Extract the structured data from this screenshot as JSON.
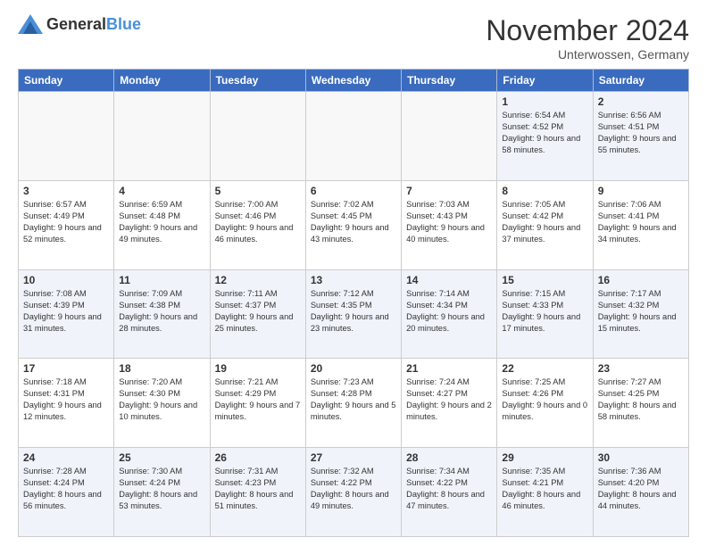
{
  "header": {
    "logo_general": "General",
    "logo_blue": "Blue",
    "month_title": "November 2024",
    "location": "Unterwossen, Germany"
  },
  "weekdays": [
    "Sunday",
    "Monday",
    "Tuesday",
    "Wednesday",
    "Thursday",
    "Friday",
    "Saturday"
  ],
  "weeks": [
    [
      {
        "day": "",
        "info": ""
      },
      {
        "day": "",
        "info": ""
      },
      {
        "day": "",
        "info": ""
      },
      {
        "day": "",
        "info": ""
      },
      {
        "day": "",
        "info": ""
      },
      {
        "day": "1",
        "info": "Sunrise: 6:54 AM\nSunset: 4:52 PM\nDaylight: 9 hours and 58 minutes."
      },
      {
        "day": "2",
        "info": "Sunrise: 6:56 AM\nSunset: 4:51 PM\nDaylight: 9 hours and 55 minutes."
      }
    ],
    [
      {
        "day": "3",
        "info": "Sunrise: 6:57 AM\nSunset: 4:49 PM\nDaylight: 9 hours and 52 minutes."
      },
      {
        "day": "4",
        "info": "Sunrise: 6:59 AM\nSunset: 4:48 PM\nDaylight: 9 hours and 49 minutes."
      },
      {
        "day": "5",
        "info": "Sunrise: 7:00 AM\nSunset: 4:46 PM\nDaylight: 9 hours and 46 minutes."
      },
      {
        "day": "6",
        "info": "Sunrise: 7:02 AM\nSunset: 4:45 PM\nDaylight: 9 hours and 43 minutes."
      },
      {
        "day": "7",
        "info": "Sunrise: 7:03 AM\nSunset: 4:43 PM\nDaylight: 9 hours and 40 minutes."
      },
      {
        "day": "8",
        "info": "Sunrise: 7:05 AM\nSunset: 4:42 PM\nDaylight: 9 hours and 37 minutes."
      },
      {
        "day": "9",
        "info": "Sunrise: 7:06 AM\nSunset: 4:41 PM\nDaylight: 9 hours and 34 minutes."
      }
    ],
    [
      {
        "day": "10",
        "info": "Sunrise: 7:08 AM\nSunset: 4:39 PM\nDaylight: 9 hours and 31 minutes."
      },
      {
        "day": "11",
        "info": "Sunrise: 7:09 AM\nSunset: 4:38 PM\nDaylight: 9 hours and 28 minutes."
      },
      {
        "day": "12",
        "info": "Sunrise: 7:11 AM\nSunset: 4:37 PM\nDaylight: 9 hours and 25 minutes."
      },
      {
        "day": "13",
        "info": "Sunrise: 7:12 AM\nSunset: 4:35 PM\nDaylight: 9 hours and 23 minutes."
      },
      {
        "day": "14",
        "info": "Sunrise: 7:14 AM\nSunset: 4:34 PM\nDaylight: 9 hours and 20 minutes."
      },
      {
        "day": "15",
        "info": "Sunrise: 7:15 AM\nSunset: 4:33 PM\nDaylight: 9 hours and 17 minutes."
      },
      {
        "day": "16",
        "info": "Sunrise: 7:17 AM\nSunset: 4:32 PM\nDaylight: 9 hours and 15 minutes."
      }
    ],
    [
      {
        "day": "17",
        "info": "Sunrise: 7:18 AM\nSunset: 4:31 PM\nDaylight: 9 hours and 12 minutes."
      },
      {
        "day": "18",
        "info": "Sunrise: 7:20 AM\nSunset: 4:30 PM\nDaylight: 9 hours and 10 minutes."
      },
      {
        "day": "19",
        "info": "Sunrise: 7:21 AM\nSunset: 4:29 PM\nDaylight: 9 hours and 7 minutes."
      },
      {
        "day": "20",
        "info": "Sunrise: 7:23 AM\nSunset: 4:28 PM\nDaylight: 9 hours and 5 minutes."
      },
      {
        "day": "21",
        "info": "Sunrise: 7:24 AM\nSunset: 4:27 PM\nDaylight: 9 hours and 2 minutes."
      },
      {
        "day": "22",
        "info": "Sunrise: 7:25 AM\nSunset: 4:26 PM\nDaylight: 9 hours and 0 minutes."
      },
      {
        "day": "23",
        "info": "Sunrise: 7:27 AM\nSunset: 4:25 PM\nDaylight: 8 hours and 58 minutes."
      }
    ],
    [
      {
        "day": "24",
        "info": "Sunrise: 7:28 AM\nSunset: 4:24 PM\nDaylight: 8 hours and 56 minutes."
      },
      {
        "day": "25",
        "info": "Sunrise: 7:30 AM\nSunset: 4:24 PM\nDaylight: 8 hours and 53 minutes."
      },
      {
        "day": "26",
        "info": "Sunrise: 7:31 AM\nSunset: 4:23 PM\nDaylight: 8 hours and 51 minutes."
      },
      {
        "day": "27",
        "info": "Sunrise: 7:32 AM\nSunset: 4:22 PM\nDaylight: 8 hours and 49 minutes."
      },
      {
        "day": "28",
        "info": "Sunrise: 7:34 AM\nSunset: 4:22 PM\nDaylight: 8 hours and 47 minutes."
      },
      {
        "day": "29",
        "info": "Sunrise: 7:35 AM\nSunset: 4:21 PM\nDaylight: 8 hours and 46 minutes."
      },
      {
        "day": "30",
        "info": "Sunrise: 7:36 AM\nSunset: 4:20 PM\nDaylight: 8 hours and 44 minutes."
      }
    ]
  ]
}
